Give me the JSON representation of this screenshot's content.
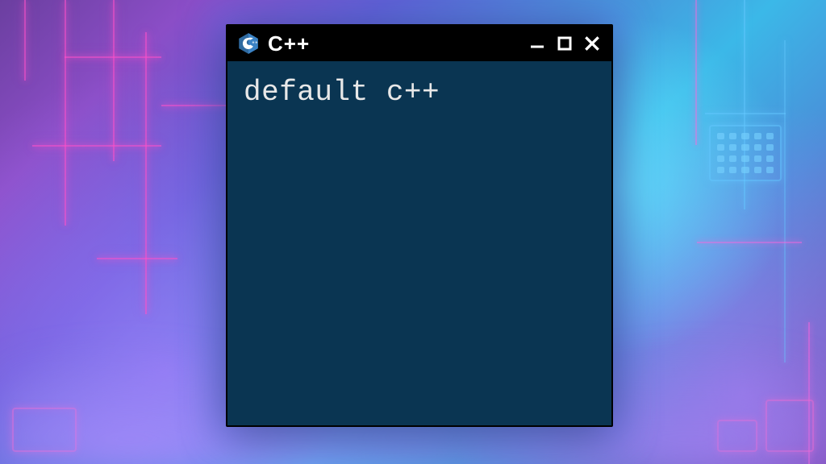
{
  "window": {
    "title": "C++",
    "icon_name": "cpp-logo-icon"
  },
  "terminal": {
    "content": "default c++"
  },
  "colors": {
    "terminal_bg": "#0a3552",
    "terminal_fg": "#e8e8e8",
    "titlebar_bg": "#000000",
    "cpp_logo_blue": "#2f6aa0",
    "glow": "rgba(100,120,255,0.35)"
  }
}
